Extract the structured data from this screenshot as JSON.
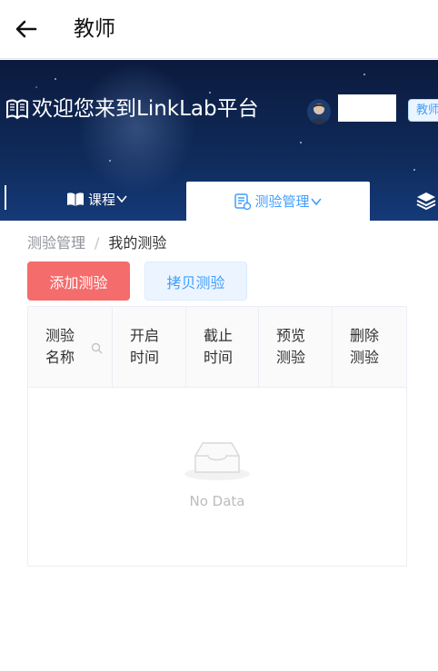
{
  "appbar": {
    "title": "教师",
    "back_icon": "arrow-left-icon"
  },
  "banner": {
    "brand_text": "欢迎您来到LinkLab平台",
    "brand_icon": "book-icon",
    "username": "",
    "role_badge": "教师"
  },
  "nav": {
    "items": [
      {
        "label": "课程",
        "icon": "book-open-icon",
        "chevron": "chevron-down-icon"
      },
      {
        "label": "测验管理",
        "icon": "quiz-icon",
        "chevron": "chevron-down-icon",
        "active": true
      },
      {
        "label": "",
        "icon": "layers-icon"
      }
    ]
  },
  "breadcrumb": {
    "parent": "测验管理",
    "separator": "/",
    "current": "我的测验"
  },
  "actions": {
    "add_label": "添加测验",
    "copy_label": "拷贝测验"
  },
  "table": {
    "columns": [
      "测验名称",
      "开启时间",
      "截止时间",
      "预览测验",
      "删除测验"
    ],
    "rows": [],
    "empty_text": "No Data"
  },
  "colors": {
    "danger": "#f56c6c",
    "primary": "#409eff",
    "primary_light": "#ecf5ff",
    "banner_dark": "#0b1a3d"
  }
}
